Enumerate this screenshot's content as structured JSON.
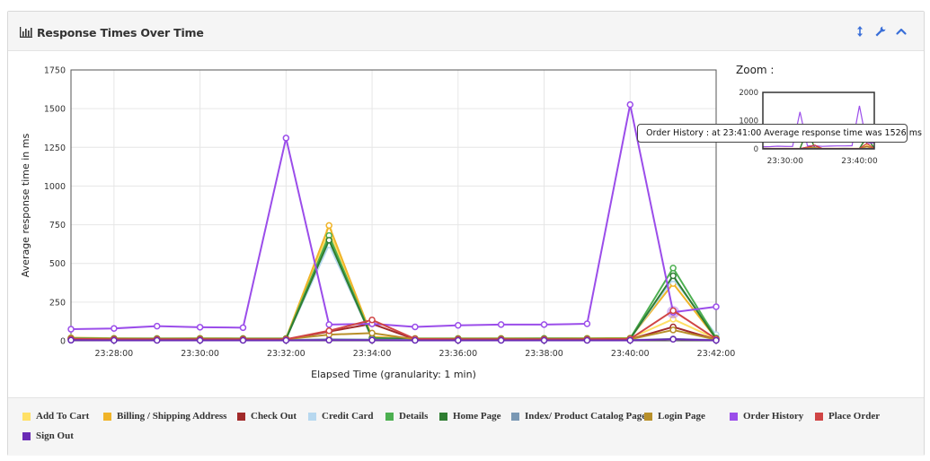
{
  "panel": {
    "title": "Response Times Over Time",
    "title_icon": "bar-chart-icon",
    "buttons": [
      {
        "name": "resize-icon",
        "label": ""
      },
      {
        "name": "wrench-icon",
        "label": ""
      },
      {
        "name": "collapse-chevron-icon",
        "label": ""
      }
    ]
  },
  "zoom": {
    "title": "Zoom :"
  },
  "tooltip": {
    "text": "Order History : at 23:41:00 Average response time was 1526 ms"
  },
  "chart_data": {
    "type": "line",
    "title": "",
    "xlabel": "Elapsed Time (granularity: 1 min)",
    "ylabel": "Average response time in ms",
    "ylim": [
      0,
      1750
    ],
    "yticks": [
      0,
      250,
      500,
      750,
      1000,
      1250,
      1500,
      1750
    ],
    "xlim": [
      "23:27:00",
      "23:42:00"
    ],
    "xticks": [
      "23:28:00",
      "23:30:00",
      "23:32:00",
      "23:34:00",
      "23:36:00",
      "23:38:00",
      "23:40:00",
      "23:42:00"
    ],
    "grid": true,
    "x": [
      "23:27:00",
      "23:28:00",
      "23:29:00",
      "23:30:00",
      "23:31:00",
      "23:32:00",
      "23:33:00",
      "23:34:00",
      "23:35:00",
      "23:36:00",
      "23:37:00",
      "23:38:00",
      "23:39:00",
      "23:40:00",
      "23:41:00",
      "23:42:00"
    ],
    "series": [
      {
        "name": "Add To Cart",
        "color": "#ffe066",
        "values": [
          18,
          15,
          14,
          15,
          14,
          14,
          710,
          20,
          16,
          15,
          16,
          15,
          15,
          16,
          140,
          12
        ]
      },
      {
        "name": "Billing / Shipping Address",
        "color": "#f0b429",
        "values": [
          20,
          17,
          16,
          17,
          16,
          16,
          745,
          25,
          15,
          16,
          16,
          16,
          17,
          18,
          370,
          15
        ]
      },
      {
        "name": "Check Out",
        "color": "#a12a2a",
        "values": [
          10,
          9,
          9,
          10,
          9,
          9,
          60,
          110,
          10,
          9,
          9,
          10,
          9,
          10,
          90,
          8
        ]
      },
      {
        "name": "Credit Card",
        "color": "#b7d8ef",
        "values": [
          15,
          14,
          14,
          14,
          14,
          14,
          620,
          18,
          14,
          14,
          14,
          14,
          14,
          15,
          400,
          40
        ]
      },
      {
        "name": "Details",
        "color": "#4caf50",
        "values": [
          16,
          14,
          14,
          14,
          14,
          14,
          680,
          18,
          14,
          14,
          14,
          15,
          14,
          15,
          470,
          18
        ]
      },
      {
        "name": "Home Page",
        "color": "#2f7d32",
        "values": [
          14,
          12,
          12,
          12,
          12,
          12,
          650,
          15,
          12,
          12,
          12,
          12,
          12,
          13,
          420,
          12
        ]
      },
      {
        "name": "Index/ Product Catalog Page",
        "color": "#7a98b4",
        "values": [
          6,
          5,
          5,
          5,
          5,
          5,
          10,
          8,
          5,
          5,
          5,
          5,
          5,
          5,
          12,
          5
        ]
      },
      {
        "name": "Login Page",
        "color": "#b8902a",
        "values": [
          12,
          10,
          10,
          10,
          10,
          10,
          40,
          50,
          10,
          10,
          10,
          10,
          10,
          10,
          70,
          8
        ]
      },
      {
        "name": "Order History",
        "color": "#9b4dea",
        "values": [
          75,
          80,
          95,
          88,
          85,
          1310,
          105,
          110,
          90,
          100,
          105,
          105,
          110,
          1526,
          185,
          220
        ]
      },
      {
        "name": "Place Order",
        "color": "#d04545",
        "values": [
          12,
          10,
          10,
          10,
          10,
          10,
          65,
          135,
          12,
          10,
          10,
          10,
          10,
          12,
          195,
          12
        ]
      },
      {
        "name": "Sign Out",
        "color": "#6a2bb5",
        "values": [
          4,
          3,
          3,
          3,
          3,
          3,
          4,
          4,
          3,
          3,
          3,
          3,
          3,
          3,
          10,
          3
        ]
      }
    ],
    "highlight": {
      "series": "Order History",
      "x": "23:41:00",
      "value": 1526
    },
    "navigator": {
      "ylim": [
        0,
        2000
      ],
      "yticks": [
        0,
        1000,
        2000
      ],
      "xticks": [
        "23:30:00",
        "23:40:00"
      ]
    }
  }
}
